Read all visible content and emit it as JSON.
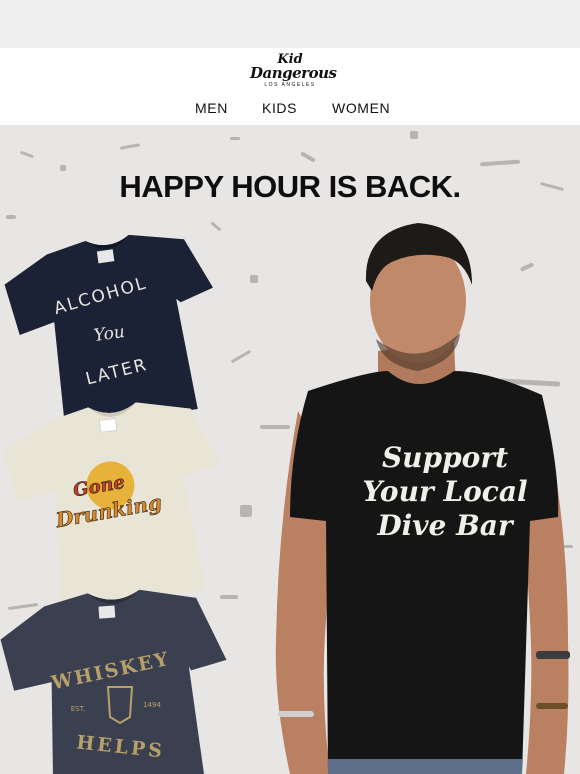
{
  "brand": {
    "line1": "Kid",
    "line2": "Dangerous",
    "line3": "LOS ANGELES"
  },
  "nav": {
    "items": [
      "MEN",
      "KIDS",
      "WOMEN"
    ]
  },
  "hero": {
    "title": "HAPPY HOUR IS BACK.",
    "shirt1": {
      "top": "ALCOHOL",
      "middle": "You",
      "bottom": "LATER"
    },
    "shirt2": {
      "line1": "Gone",
      "line2": "Drunking"
    },
    "shirt3": {
      "top": "WHISKEY",
      "left": "EST.",
      "right": "1494",
      "bottom": "HELPS"
    },
    "featured_shirt": {
      "line1": "Support",
      "line2": "Your Local",
      "line3": "Dive Bar"
    }
  },
  "colors": {
    "navy": "#1c2235",
    "cream": "#e9e5d6",
    "heather": "#3b4050",
    "black": "#151515",
    "gold": "#b8a06a",
    "orange": "#d98a2b"
  }
}
